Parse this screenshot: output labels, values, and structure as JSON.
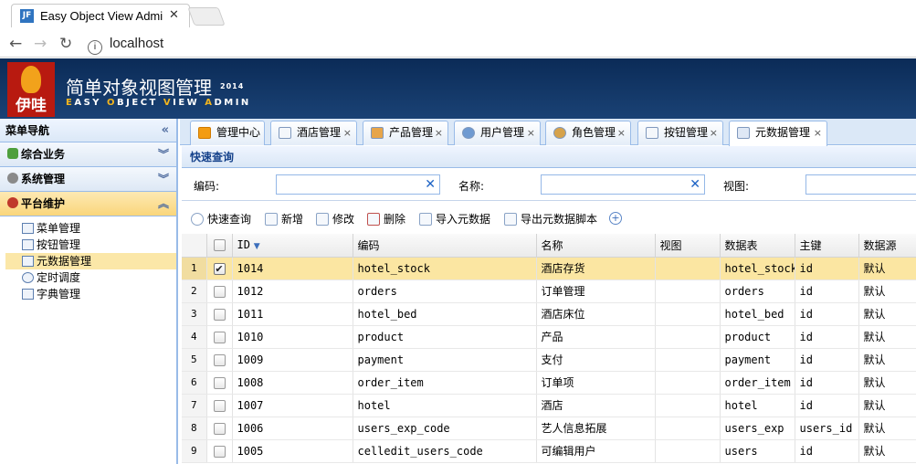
{
  "browser": {
    "tab_title": "Easy Object View Admi",
    "tab_close": "✕",
    "favicon_text": "JF",
    "url": "localhost",
    "back": "←",
    "forward": "→",
    "reload": "↻"
  },
  "header": {
    "logo_text": "伊哇",
    "title": "简单对象视图管理",
    "year": "2014",
    "subtitle_parts": [
      "E",
      "ASY ",
      "O",
      "BJECT ",
      "V",
      "IEW ",
      "A",
      "DMIN"
    ]
  },
  "sidebar": {
    "title": "菜单导航",
    "collapse": "«",
    "groups": [
      {
        "label": "综合业务",
        "toggle": "︾",
        "color": "#4e9f3d"
      },
      {
        "label": "系统管理",
        "toggle": "︾",
        "color": "#8a8a8a"
      },
      {
        "label": "平台维护",
        "toggle": "︽",
        "color": "#c0392b"
      }
    ],
    "items": [
      {
        "label": "菜单管理"
      },
      {
        "label": "按钮管理"
      },
      {
        "label": "元数据管理"
      },
      {
        "label": "定时调度"
      },
      {
        "label": "字典管理"
      }
    ]
  },
  "tabs": [
    {
      "label": "管理中心"
    },
    {
      "label": "酒店管理"
    },
    {
      "label": "产品管理"
    },
    {
      "label": "用户管理"
    },
    {
      "label": "角色管理"
    },
    {
      "label": "按钮管理"
    },
    {
      "label": "元数据管理"
    }
  ],
  "tab_close": "×",
  "query": {
    "title": "快速查询",
    "code_label": "编码:",
    "name_label": "名称:",
    "view_label": "视图:",
    "clear": "✕"
  },
  "toolbar": {
    "search": "快速查询",
    "add": "新增",
    "edit": "修改",
    "delete": "删除",
    "import": "导入元数据",
    "export": "导出元数据脚本",
    "more": "+"
  },
  "grid": {
    "columns": [
      "ID",
      "编码",
      "名称",
      "视图",
      "数据表",
      "主键",
      "数据源"
    ],
    "sort_indicator": "▼",
    "rows": [
      {
        "n": "1",
        "id": "1014",
        "code": "hotel_stock",
        "name": "酒店存货",
        "view": "",
        "table": "hotel_stock",
        "pk": "id",
        "ds": "默认",
        "checked": true
      },
      {
        "n": "2",
        "id": "1012",
        "code": "orders",
        "name": "订单管理",
        "view": "",
        "table": "orders",
        "pk": "id",
        "ds": "默认",
        "checked": false
      },
      {
        "n": "3",
        "id": "1011",
        "code": "hotel_bed",
        "name": "酒店床位",
        "view": "",
        "table": "hotel_bed",
        "pk": "id",
        "ds": "默认",
        "checked": false
      },
      {
        "n": "4",
        "id": "1010",
        "code": "product",
        "name": "产品",
        "view": "",
        "table": "product",
        "pk": "id",
        "ds": "默认",
        "checked": false
      },
      {
        "n": "5",
        "id": "1009",
        "code": "payment",
        "name": "支付",
        "view": "",
        "table": "payment",
        "pk": "id",
        "ds": "默认",
        "checked": false
      },
      {
        "n": "6",
        "id": "1008",
        "code": "order_item",
        "name": "订单项",
        "view": "",
        "table": "order_item",
        "pk": "id",
        "ds": "默认",
        "checked": false
      },
      {
        "n": "7",
        "id": "1007",
        "code": "hotel",
        "name": "酒店",
        "view": "",
        "table": "hotel",
        "pk": "id",
        "ds": "默认",
        "checked": false
      },
      {
        "n": "8",
        "id": "1006",
        "code": "users_exp_code",
        "name": "艺人信息拓展",
        "view": "",
        "table": "users_exp",
        "pk": "users_id",
        "ds": "默认",
        "checked": false
      },
      {
        "n": "9",
        "id": "1005",
        "code": "celledit_users_code",
        "name": "可编辑用户",
        "view": "",
        "table": "users",
        "pk": "id",
        "ds": "默认",
        "checked": false
      }
    ]
  }
}
